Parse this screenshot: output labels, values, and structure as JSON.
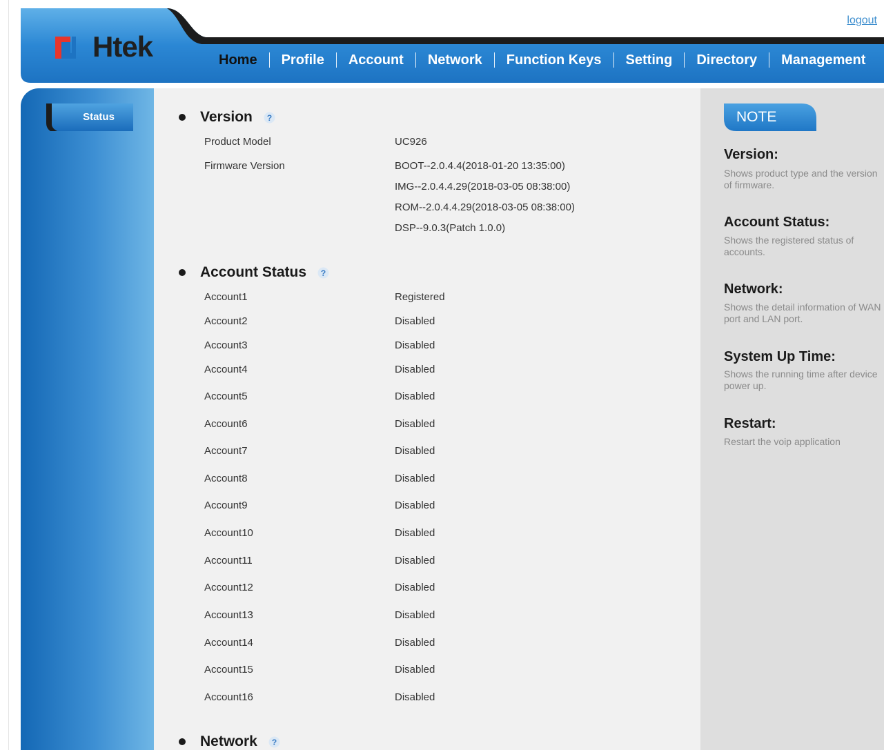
{
  "header": {
    "logo_text": "Htek",
    "logout_label": "logout",
    "nav": [
      "Home",
      "Profile",
      "Account",
      "Network",
      "Function Keys",
      "Setting",
      "Directory",
      "Management"
    ],
    "active_nav": "Home"
  },
  "sidebar": {
    "tab_label": "Status"
  },
  "main": {
    "version": {
      "title": "Version",
      "product_model_label": "Product Model",
      "product_model_value": "UC926",
      "firmware_label": "Firmware Version",
      "firmware_values": [
        "BOOT--2.0.4.4(2018-01-20 13:35:00)",
        "IMG--2.0.4.4.29(2018-03-05 08:38:00)",
        "ROM--2.0.4.4.29(2018-03-05 08:38:00)",
        "DSP--9.0.3(Patch 1.0.0)"
      ]
    },
    "account_status": {
      "title": "Account Status",
      "rows": [
        {
          "label": "Account1",
          "value": "Registered"
        },
        {
          "label": "Account2",
          "value": "Disabled"
        },
        {
          "label": "Account3",
          "value": "Disabled"
        },
        {
          "label": "Account4",
          "value": "Disabled"
        },
        {
          "label": "Account5",
          "value": "Disabled"
        },
        {
          "label": "Account6",
          "value": "Disabled"
        },
        {
          "label": "Account7",
          "value": "Disabled"
        },
        {
          "label": "Account8",
          "value": "Disabled"
        },
        {
          "label": "Account9",
          "value": "Disabled"
        },
        {
          "label": "Account10",
          "value": "Disabled"
        },
        {
          "label": "Account11",
          "value": "Disabled"
        },
        {
          "label": "Account12",
          "value": "Disabled"
        },
        {
          "label": "Account13",
          "value": "Disabled"
        },
        {
          "label": "Account14",
          "value": "Disabled"
        },
        {
          "label": "Account15",
          "value": "Disabled"
        },
        {
          "label": "Account16",
          "value": "Disabled"
        }
      ]
    },
    "network": {
      "title": "Network"
    }
  },
  "note": {
    "tab_label": "NOTE",
    "items": [
      {
        "heading": "Version:",
        "text": "Shows product type and the version\nof firmware."
      },
      {
        "heading": "Account Status:",
        "text": "Shows the registered status of\naccounts."
      },
      {
        "heading": "Network:",
        "text": "Shows the detail information of WAN\nport and LAN port."
      },
      {
        "heading": "System Up Time:",
        "text": "Shows the running time after device\npower up."
      },
      {
        "heading": "Restart:",
        "text": "Restart the voip application"
      }
    ]
  },
  "colors": {
    "brand_blue": "#2a7fcb",
    "header_dark": "#1c1c1c",
    "link": "#3f8fcf",
    "content_bg": "#f1f1f1",
    "note_bg": "#dedede"
  },
  "icons": {
    "help": "question-circle-icon"
  }
}
